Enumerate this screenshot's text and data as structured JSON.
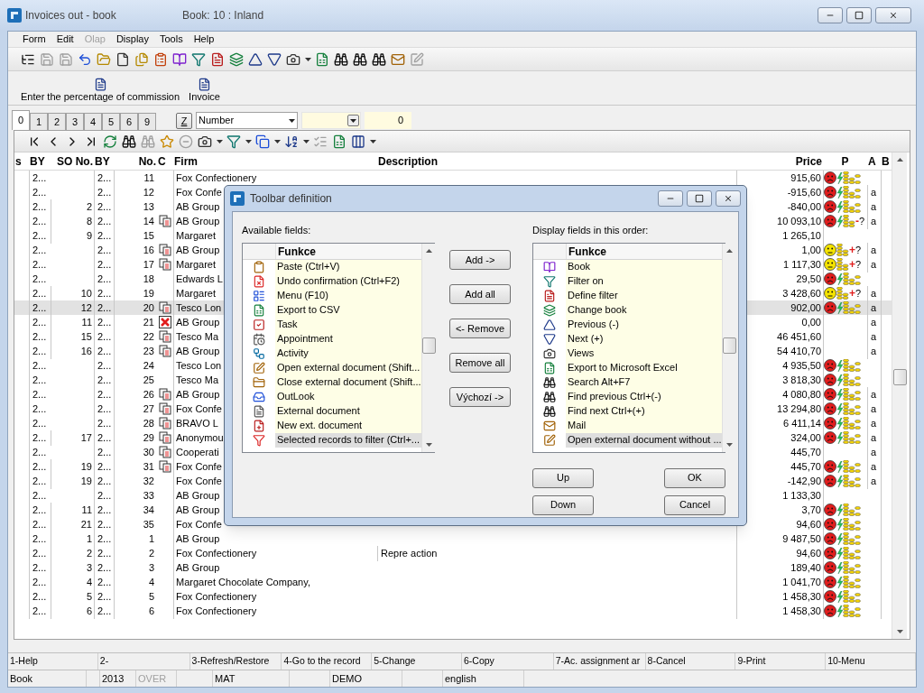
{
  "window": {
    "title": "Invoices out - book",
    "subtitle": "Book: 10 : Inland"
  },
  "menu": [
    {
      "label": "Form",
      "disabled": false
    },
    {
      "label": "Edit",
      "disabled": false
    },
    {
      "label": "Olap",
      "disabled": true
    },
    {
      "label": "Display",
      "disabled": false
    },
    {
      "label": "Tools",
      "disabled": false
    },
    {
      "label": "Help",
      "disabled": false
    }
  ],
  "command_buttons": [
    "Enter the percentage of commission",
    "Invoice"
  ],
  "tabs": [
    {
      "label": "0",
      "selected": true
    },
    {
      "label": "1",
      "selected": false
    },
    {
      "label": "2",
      "selected": false
    },
    {
      "label": "3",
      "selected": false
    },
    {
      "label": "4",
      "selected": false
    },
    {
      "label": "5",
      "selected": false
    },
    {
      "label": "6",
      "selected": false
    },
    {
      "label": "9",
      "selected": false
    }
  ],
  "sort_button": "Z",
  "sort_field": {
    "value": "Number"
  },
  "filter_value": "0",
  "table": {
    "columns": [
      "s",
      "BY",
      "SO No.",
      "BY",
      "No.",
      "C",
      "Firm",
      "Description",
      "Price",
      "P",
      "A",
      "B"
    ],
    "rows": [
      {
        "by": "2...",
        "so": "",
        "bye": "2...",
        "no": "11",
        "firm": "Fox Confectionery",
        "price": "915,60",
        "p": {
          "kind": "sad"
        },
        "a": "",
        "selected": false
      },
      {
        "by": "2...",
        "so": "",
        "bye": "2...",
        "no": "12",
        "firm": "Fox Confe",
        "price": "-915,60",
        "p": {
          "kind": "sad"
        },
        "a": "a",
        "selected": false
      },
      {
        "by": "2...",
        "so": "2",
        "bye": "2...",
        "no": "13",
        "firm": "AB Group",
        "price": "-840,00",
        "p": {
          "kind": "sad"
        },
        "a": "a",
        "selected": false
      },
      {
        "by": "2...",
        "so": "8",
        "bye": "2...",
        "no": "14",
        "c": {
          "kind": "doc"
        },
        "firm": "AB Group",
        "price": "10 093,10",
        "p": {
          "kind": "sad",
          "sign": "-",
          "note": "?"
        },
        "a": "a",
        "selected": false
      },
      {
        "by": "2...",
        "so": "9",
        "bye": "2...",
        "no": "15",
        "firm": "Margaret",
        "price": "1 265,10",
        "a": "",
        "selected": false
      },
      {
        "by": "2...",
        "so": "",
        "bye": "2...",
        "no": "16",
        "c": {
          "kind": "doc"
        },
        "firm": "AB Group",
        "price": "1,00",
        "p": {
          "kind": "neutral",
          "sign": "+",
          "note": "?"
        },
        "a": "a",
        "selected": false
      },
      {
        "by": "2...",
        "so": "",
        "bye": "2...",
        "no": "17",
        "c": {
          "kind": "doc"
        },
        "firm": "Margaret",
        "price": "1 117,30",
        "p": {
          "kind": "neutral",
          "sign": "+",
          "note": "?"
        },
        "a": "a",
        "selected": false
      },
      {
        "by": "2...",
        "so": "",
        "bye": "2...",
        "no": "18",
        "firm": "Edwards L",
        "price": "29,50",
        "p": {
          "kind": "sad"
        },
        "a": "",
        "selected": false
      },
      {
        "by": "2...",
        "so": "10",
        "bye": "2...",
        "no": "19",
        "firm": "Margaret",
        "price": "3 428,60",
        "p": {
          "kind": "neutral",
          "sign": "+",
          "note": "?"
        },
        "a": "a",
        "selected": false
      },
      {
        "by": "2...",
        "so": "12",
        "bye": "2...",
        "no": "20",
        "c": {
          "kind": "doc"
        },
        "firm": "Tesco Lon",
        "price": "902,00",
        "p": {
          "kind": "sad"
        },
        "a": "a",
        "selected": true
      },
      {
        "by": "2...",
        "so": "11",
        "bye": "2...",
        "no": "21",
        "c": {
          "kind": "cancelled"
        },
        "firm": "AB Group",
        "price": "0,00",
        "a": "a",
        "selected": false
      },
      {
        "by": "2...",
        "so": "15",
        "bye": "2...",
        "no": "22",
        "c": {
          "kind": "doc"
        },
        "firm": "Tesco Ma",
        "price": "46 451,60",
        "a": "a",
        "selected": false
      },
      {
        "by": "2...",
        "so": "16",
        "bye": "2...",
        "no": "23",
        "c": {
          "kind": "doc"
        },
        "firm": "AB Group",
        "price": "54 410,70",
        "a": "a",
        "selected": false
      },
      {
        "by": "2...",
        "so": "",
        "bye": "2...",
        "no": "24",
        "firm": "Tesco Lon",
        "price": "4 935,50",
        "p": {
          "kind": "sad"
        },
        "a": "",
        "selected": false
      },
      {
        "by": "2...",
        "so": "",
        "bye": "2...",
        "no": "25",
        "firm": "Tesco Ma",
        "price": "3 818,30",
        "p": {
          "kind": "sad"
        },
        "a": "",
        "selected": false
      },
      {
        "by": "2...",
        "so": "",
        "bye": "2...",
        "no": "26",
        "c": {
          "kind": "doc"
        },
        "firm": "AB Group",
        "price": "4 080,80",
        "p": {
          "kind": "sad"
        },
        "a": "a",
        "selected": false
      },
      {
        "by": "2...",
        "so": "",
        "bye": "2...",
        "no": "27",
        "c": {
          "kind": "doc"
        },
        "firm": "Fox Confe",
        "price": "13 294,80",
        "p": {
          "kind": "sad"
        },
        "a": "a",
        "selected": false
      },
      {
        "by": "2...",
        "so": "",
        "bye": "2...",
        "no": "28",
        "c": {
          "kind": "doc"
        },
        "firm": "BRAVO L",
        "price": "6 411,14",
        "p": {
          "kind": "sad"
        },
        "a": "a",
        "selected": false
      },
      {
        "by": "2...",
        "so": "17",
        "bye": "2...",
        "no": "29",
        "c": {
          "kind": "doc"
        },
        "firm": "Anonymou",
        "price": "324,00",
        "p": {
          "kind": "sad"
        },
        "a": "a",
        "selected": false
      },
      {
        "by": "2...",
        "so": "",
        "bye": "2...",
        "no": "30",
        "c": {
          "kind": "doc"
        },
        "firm": "Cooperati",
        "price": "445,70",
        "a": "a",
        "selected": false
      },
      {
        "by": "2...",
        "so": "19",
        "bye": "2...",
        "no": "31",
        "c": {
          "kind": "doc"
        },
        "firm": "Fox Confe",
        "price": "445,70",
        "p": {
          "kind": "sad"
        },
        "a": "a",
        "selected": false
      },
      {
        "by": "2...",
        "so": "19",
        "bye": "2...",
        "no": "32",
        "firm": "Fox Confe",
        "price": "-142,90",
        "p": {
          "kind": "sad"
        },
        "a": "a",
        "selected": false
      },
      {
        "by": "2...",
        "so": "",
        "bye": "2...",
        "no": "33",
        "firm": "AB Group",
        "price": "1 133,30",
        "a": "",
        "selected": false
      },
      {
        "by": "2...",
        "so": "11",
        "bye": "2...",
        "no": "34",
        "firm": "AB Group",
        "price": "3,70",
        "p": {
          "kind": "sad"
        },
        "a": "",
        "selected": false
      },
      {
        "by": "2...",
        "so": "21",
        "bye": "2...",
        "no": "35",
        "firm": "Fox Confe",
        "price": "94,60",
        "p": {
          "kind": "sad"
        },
        "a": "",
        "selected": false
      },
      {
        "by": "2...",
        "so": "1",
        "bye": "2...",
        "no": "1",
        "firm": "AB Group",
        "price": "9 487,50",
        "p": {
          "kind": "sad"
        },
        "a": "",
        "selected": false
      },
      {
        "by": "2...",
        "so": "2",
        "bye": "2...",
        "no": "2",
        "firm": "Fox Confectionery",
        "description": "Repre action",
        "price": "94,60",
        "p": {
          "kind": "sad"
        },
        "a": "",
        "selected": false
      },
      {
        "by": "2...",
        "so": "3",
        "bye": "2...",
        "no": "3",
        "firm": "AB Group",
        "price": "189,40",
        "p": {
          "kind": "sad"
        },
        "a": "",
        "selected": false
      },
      {
        "by": "2...",
        "so": "4",
        "bye": "2...",
        "no": "4",
        "firm": "Margaret Chocolate Company,",
        "price": "1 041,70",
        "p": {
          "kind": "sad"
        },
        "a": "",
        "selected": false
      },
      {
        "by": "2...",
        "so": "5",
        "bye": "2...",
        "no": "5",
        "firm": "Fox Confectionery",
        "price": "1 458,30",
        "p": {
          "kind": "sad"
        },
        "a": "",
        "selected": false
      },
      {
        "by": "2...",
        "so": "6",
        "bye": "2...",
        "no": "6",
        "firm": "Fox Confectionery",
        "price": "1 458,30",
        "p": {
          "kind": "sad"
        },
        "a": "",
        "selected": false
      }
    ]
  },
  "dialog": {
    "title": "Toolbar definition",
    "available_label": "Available fields:",
    "display_label": "Display fields in this order:",
    "available": {
      "column": "Funkce",
      "items": [
        {
          "label": "Paste (Ctrl+V)",
          "selected": false
        },
        {
          "label": "Undo confirmation (Ctrl+F2)",
          "selected": false
        },
        {
          "label": "Menu (F10)",
          "selected": false
        },
        {
          "label": "Export to CSV",
          "selected": false
        },
        {
          "label": "Task",
          "selected": false
        },
        {
          "label": "Appointment",
          "selected": false
        },
        {
          "label": "Activity",
          "selected": false
        },
        {
          "label": "Open external document (Shift...",
          "selected": false
        },
        {
          "label": "Close external document (Shift...",
          "selected": false
        },
        {
          "label": "OutLook",
          "selected": false
        },
        {
          "label": "External document",
          "selected": false
        },
        {
          "label": "New ext. document",
          "selected": false
        },
        {
          "label": "Selected records to filter (Ctrl+...",
          "selected": true
        }
      ]
    },
    "display": {
      "column": "Funkce",
      "items": [
        {
          "label": "Book",
          "selected": false
        },
        {
          "label": "Filter on",
          "selected": false
        },
        {
          "label": "Define filter",
          "selected": false
        },
        {
          "label": "Change book",
          "selected": false
        },
        {
          "label": "Previous (-)",
          "selected": false
        },
        {
          "label": "Next (+)",
          "selected": false
        },
        {
          "label": "Views",
          "selected": false
        },
        {
          "label": "Export to Microsoft Excel",
          "selected": false
        },
        {
          "label": "Search Alt+F7",
          "selected": false
        },
        {
          "label": "Find previous Ctrl+(-)",
          "selected": false
        },
        {
          "label": "Find next Ctrl+(+)",
          "selected": false
        },
        {
          "label": "Mail",
          "selected": false
        },
        {
          "label": "Open external document without ...",
          "selected": true
        }
      ]
    },
    "middle_buttons": [
      "Add ->",
      "Add all",
      "<- Remove",
      "Remove all",
      "Výchozí ->"
    ],
    "order_buttons": [
      "Up",
      "Down"
    ],
    "confirm_buttons": [
      "OK",
      "Cancel"
    ]
  },
  "function_keys": [
    "1-Help",
    "2-",
    "3-Refresh/Restore",
    "4-Go to the record",
    "5-Change",
    "6-Copy",
    "7-Ac. assignment ar",
    "8-Cancel",
    "9-Print",
    "10-Menu"
  ],
  "status_bar": [
    {
      "text": "Book",
      "disabled": false
    },
    {
      "text": "2013",
      "disabled": false
    },
    {
      "text": "OVER",
      "disabled": true
    },
    {
      "text": "MAT",
      "disabled": false
    },
    {
      "text": "DEMO",
      "disabled": false
    },
    {
      "text": "english",
      "disabled": false
    }
  ]
}
